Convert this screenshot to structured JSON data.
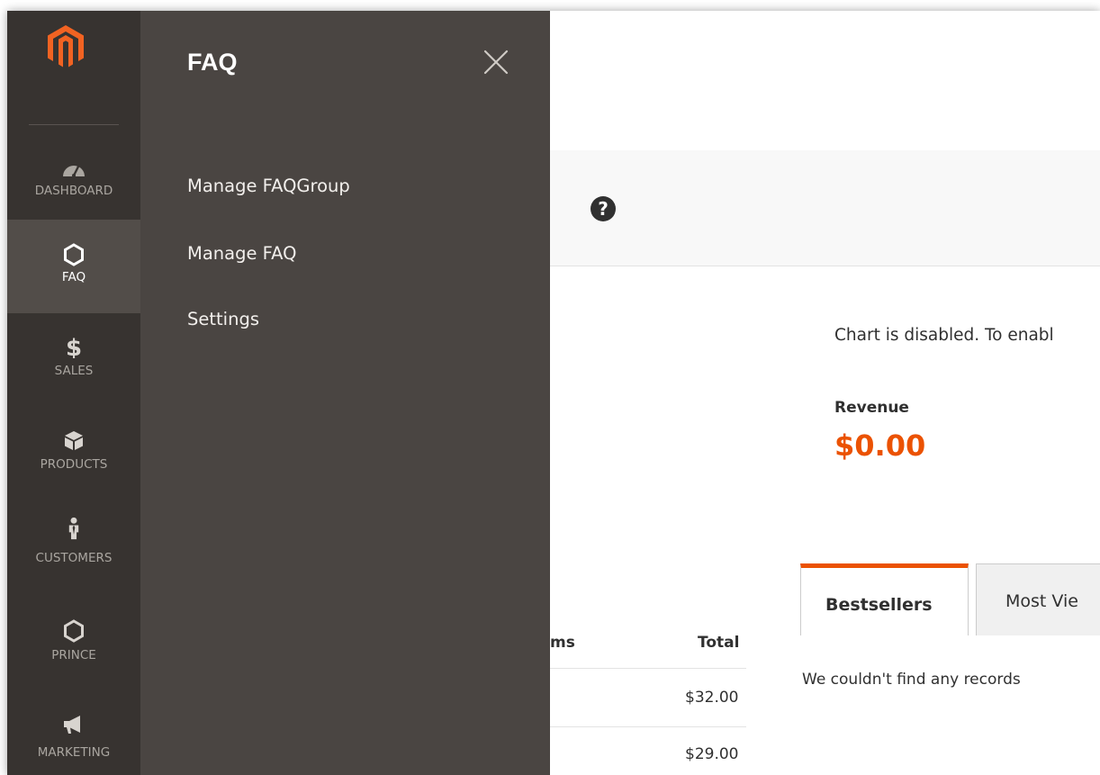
{
  "nav": {
    "items": [
      {
        "label": "DASHBOARD",
        "icon": "dashboard-gauge-icon"
      },
      {
        "label": "FAQ",
        "icon": "hexagon-icon"
      },
      {
        "label": "SALES",
        "icon": "dollar-icon"
      },
      {
        "label": "PRODUCTS",
        "icon": "box-icon"
      },
      {
        "label": "CUSTOMERS",
        "icon": "person-icon"
      },
      {
        "label": "PRINCE",
        "icon": "hexagon-icon"
      },
      {
        "label": "MARKETING",
        "icon": "megaphone-icon"
      }
    ],
    "active_index": 1
  },
  "flyout": {
    "title": "FAQ",
    "items": [
      "Manage FAQGroup",
      "Manage FAQ",
      "Settings"
    ]
  },
  "dashboard": {
    "chart_message": "Chart is disabled. To enabl",
    "revenue_label": "Revenue",
    "revenue_value": "$0.00",
    "tabs": [
      "Bestsellers",
      "Most Vie"
    ],
    "no_records": "We couldn't find any records",
    "table": {
      "headers": [
        "ms",
        "Total"
      ],
      "rows": [
        [
          "$32.00"
        ],
        [
          "$29.00"
        ]
      ]
    }
  },
  "colors": {
    "nav_bg": "#373330",
    "flyout_bg": "#4a4542",
    "accent": "#eb5202"
  }
}
